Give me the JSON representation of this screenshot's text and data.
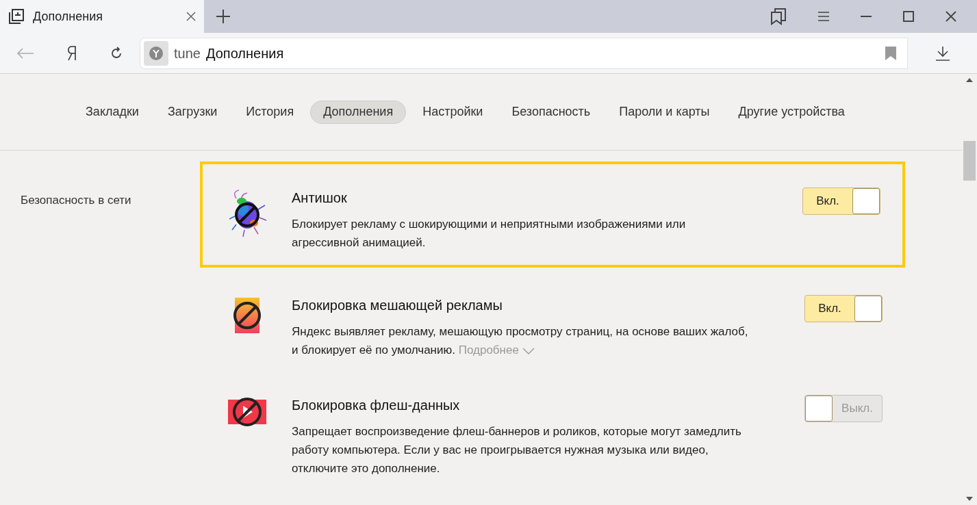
{
  "tab": {
    "title": "Дополнения"
  },
  "address": {
    "prefix": "tune",
    "text": "Дополнения"
  },
  "nav": [
    {
      "label": "Закладки",
      "selected": false
    },
    {
      "label": "Загрузки",
      "selected": false
    },
    {
      "label": "История",
      "selected": false
    },
    {
      "label": "Дополнения",
      "selected": true
    },
    {
      "label": "Настройки",
      "selected": false
    },
    {
      "label": "Безопасность",
      "selected": false
    },
    {
      "label": "Пароли и карты",
      "selected": false
    },
    {
      "label": "Другие устройства",
      "selected": false
    }
  ],
  "section": {
    "title": "Безопасность в сети"
  },
  "extensions": [
    {
      "kind": "bug",
      "title": "Антишок",
      "description": "Блокирует рекламу с шокирующими и неприятными изображениями или агрессивной анимацией.",
      "highlighted": true,
      "on": true,
      "toggle_label": "Вкл."
    },
    {
      "kind": "ad",
      "title": "Блокировка мешающей рекламы",
      "description": "Яндекс выявляет рекламу, мешающую просмотру страниц, на основе ваших жалоб, и блокирует её по умолчанию.",
      "more": "Подробнее",
      "highlighted": false,
      "on": true,
      "toggle_label": "Вкл."
    },
    {
      "kind": "flash",
      "title": "Блокировка флеш-данных",
      "description": "Запрещает воспроизведение флеш-баннеров и роликов, которые могут замедлить работу компьютера. Если у вас не проигрывается нужная музыка или видео, отключите это дополнение.",
      "highlighted": false,
      "on": false,
      "toggle_label": "Выкл."
    }
  ]
}
